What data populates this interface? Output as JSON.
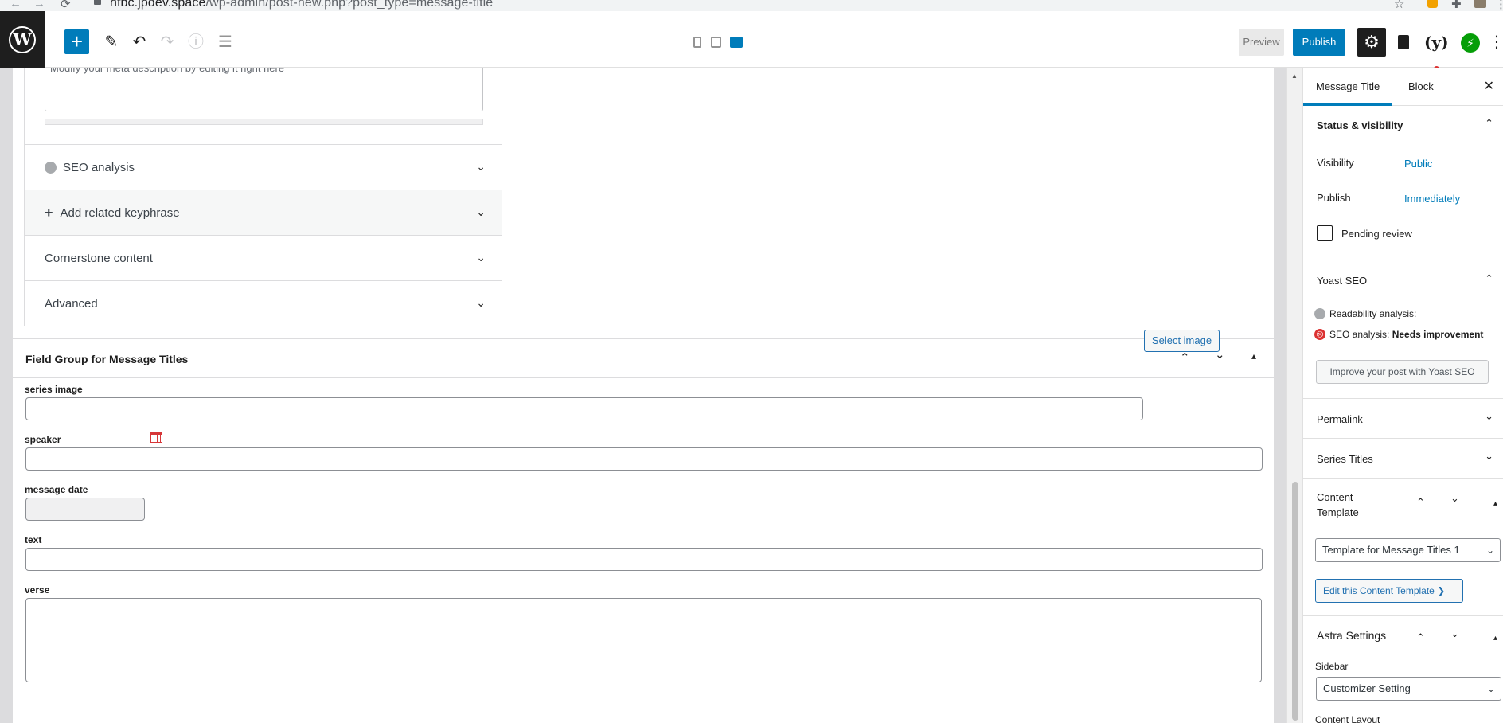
{
  "browser": {
    "back": "←",
    "forward": "→",
    "reload": "⟳",
    "url_host": "hfbc.jpdev.space",
    "url_path": "/wp-admin/post-new.php?post_type=message-title",
    "star": "☆",
    "ext_puzzle": "✚",
    "menu": "⋮"
  },
  "toolbar": {
    "add_block": "+",
    "tools": "✎",
    "undo": "↶",
    "redo": "↷",
    "info": "ⓘ",
    "outline": "☰",
    "preview_label": "Preview",
    "publish_label": "Publish",
    "settings": "⚙",
    "more": "⋮"
  },
  "yoast_metabox": {
    "meta_description_placeholder": "Modify your meta description by editing it right here",
    "sections": [
      {
        "label": "SEO analysis"
      },
      {
        "label": "Add related keyphrase"
      },
      {
        "label": "Cornerstone content"
      },
      {
        "label": "Advanced"
      }
    ],
    "chevron": "⌄"
  },
  "field_group": {
    "title": "Field Group for Message Titles",
    "move_up": "⌃",
    "move_down": "⌄",
    "toggle": "▴",
    "fields": {
      "series_image": "series image",
      "select_image_label": "Select image",
      "speaker": "speaker",
      "message_date": "message date",
      "text": "text",
      "verse": "verse"
    }
  },
  "sidebar": {
    "tabs": [
      "Message Title",
      "Block"
    ],
    "close": "✕",
    "status_visibility": {
      "title": "Status & visibility",
      "visibility_label": "Visibility",
      "visibility_value": "Public",
      "publish_label": "Publish",
      "publish_value": "Immediately",
      "pending_label": "Pending review"
    },
    "yoast_seo": {
      "title": "Yoast SEO",
      "readability": "Readability analysis:",
      "seo_label": "SEO analysis:",
      "seo_value": "Needs improvement",
      "improve_button": "Improve your post with Yoast SEO"
    },
    "permalink": "Permalink",
    "series_titles": "Series Titles",
    "content_template": {
      "title_line1": "Content",
      "title_line2": "Template",
      "selected": "Template for Message Titles 1",
      "edit_button": "Edit this Content Template ❯"
    },
    "astra_settings": {
      "title": "Astra Settings",
      "sidebar_label": "Sidebar",
      "sidebar_value": "Customizer Setting",
      "content_layout_label": "Content Layout"
    },
    "chev_up": "⌃",
    "chev_down": "⌄",
    "caret_up": "▴"
  },
  "colors": {
    "accent": "#007cba",
    "dark": "#1e1e1e",
    "error": "#dc3232"
  }
}
